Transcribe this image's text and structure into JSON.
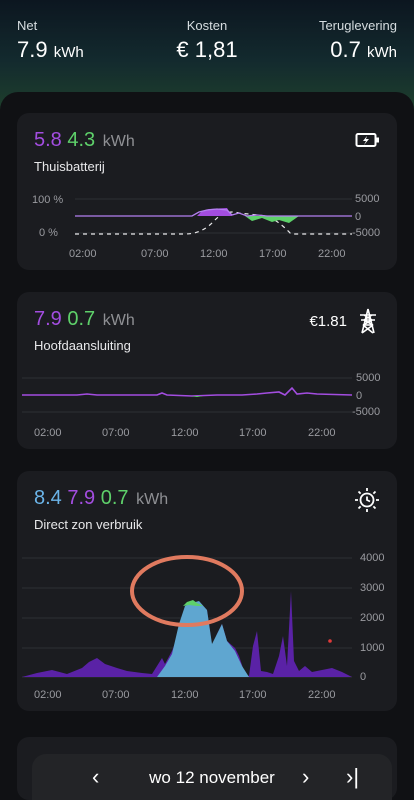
{
  "top": {
    "net": {
      "label": "Net",
      "value": "7.9",
      "unit": "kWh"
    },
    "cost": {
      "label": "Kosten",
      "value": "€ 1,81"
    },
    "feedin": {
      "label": "Teruglevering",
      "value": "0.7",
      "unit": "kWh"
    }
  },
  "battery": {
    "v1": "5.8",
    "v2": "4.3",
    "unit": "kWh",
    "title": "Thuisbatterij",
    "icon": "battery-charging-icon",
    "y_left": [
      "100 %",
      "0 %"
    ],
    "y_right": [
      "5000",
      "0",
      "-5000"
    ],
    "x_ticks": [
      "02:00",
      "07:00",
      "12:00",
      "17:00",
      "22:00"
    ]
  },
  "grid": {
    "v1": "7.9",
    "v2": "0.7",
    "unit": "kWh",
    "title": "Hoofdaansluiting",
    "cost": "€1.81",
    "icon": "power-pylon-icon",
    "y_right": [
      "5000",
      "0",
      "-5000"
    ],
    "x_ticks": [
      "02:00",
      "07:00",
      "12:00",
      "17:00",
      "22:00"
    ]
  },
  "solar": {
    "v1": "8.4",
    "v2": "7.9",
    "v3": "0.7",
    "unit": "kWh",
    "title": "Direct zon verbruik",
    "icon": "sun-clock-icon",
    "y_right": [
      "4000",
      "3000",
      "2000",
      "1000",
      "0"
    ],
    "x_ticks": [
      "02:00",
      "07:00",
      "12:00",
      "17:00",
      "22:00"
    ]
  },
  "nav": {
    "prev": "‹",
    "date": "wo 12 november",
    "next": "›",
    "last": "›|"
  },
  "colors": {
    "consumption": "#a34de0",
    "production": "#5ed06a",
    "solar": "#6bb4e8",
    "annotation": "#e07a5f"
  }
}
